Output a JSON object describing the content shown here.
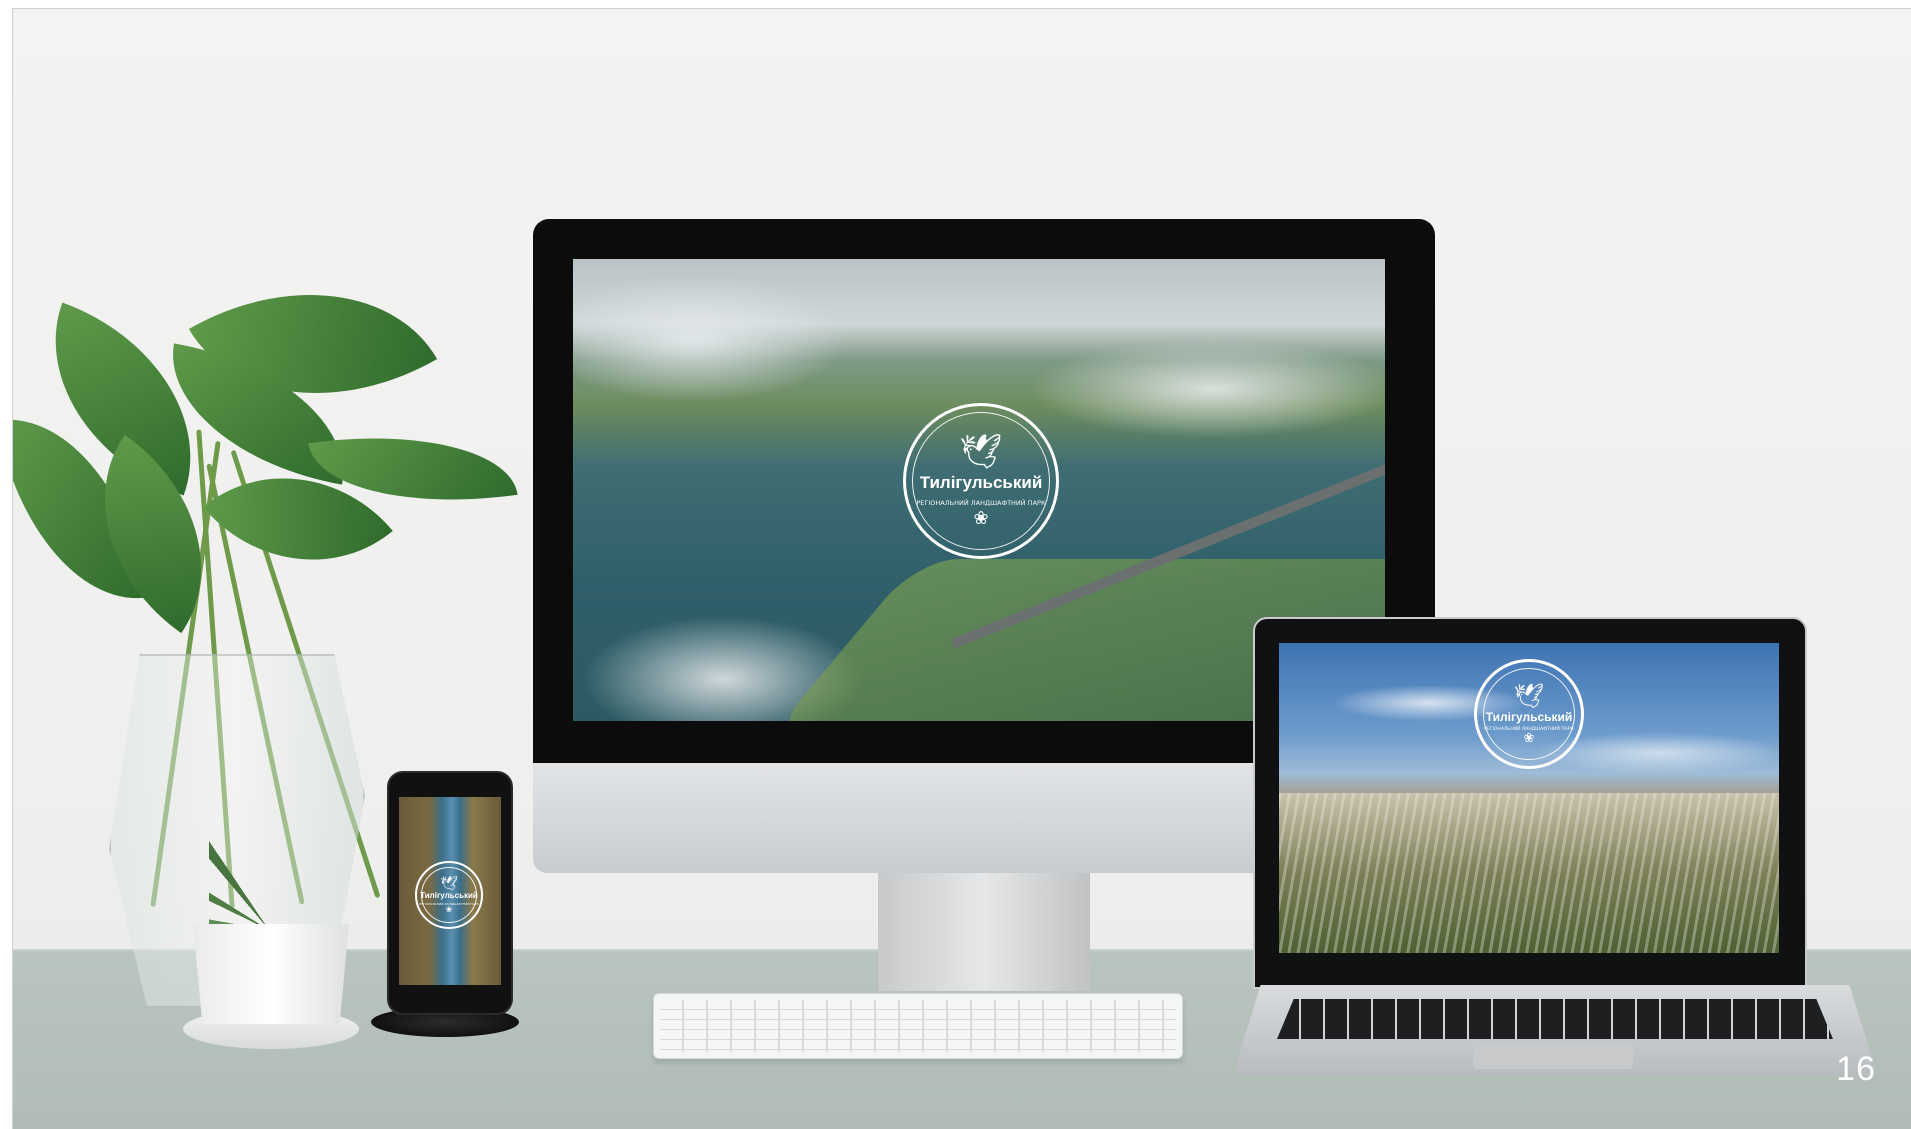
{
  "page": {
    "number": "16"
  },
  "logo": {
    "title": "Тилігульський",
    "subtitle": "РЕГІОНАЛЬНИЙ ЛАНДШАФТНИЙ ПАРК",
    "bird_icon": "heron-icon",
    "lotus_icon": "lotus-icon"
  },
  "devices": {
    "desktop_screen": "aerial-estuary-photo",
    "laptop_screen": "feather-grass-photo",
    "phone_screen": "aerial-river-photo"
  },
  "colors": {
    "logo": "#ffffff",
    "wall": "#f0f0ee",
    "desk": "#b5c0bb",
    "plant": "#3f7a36"
  }
}
